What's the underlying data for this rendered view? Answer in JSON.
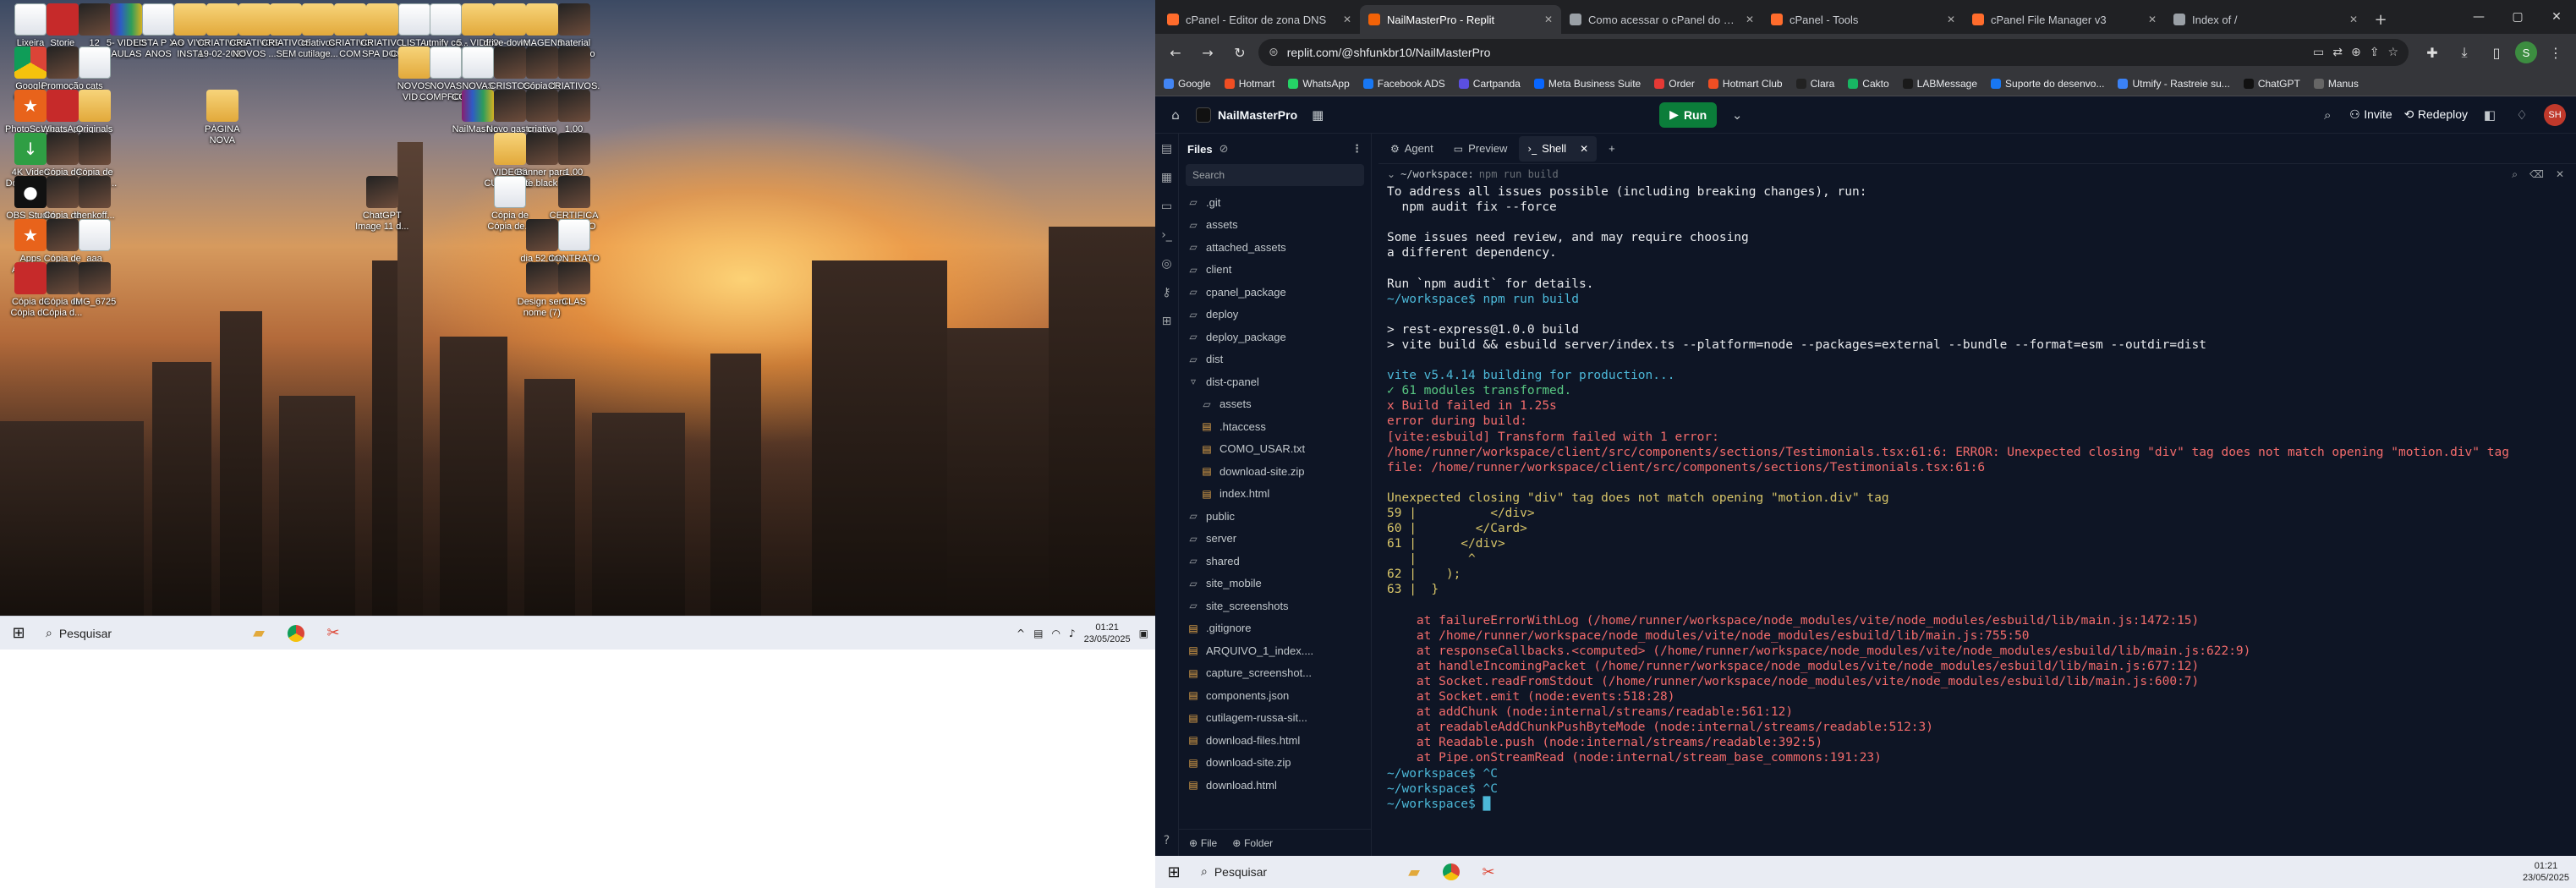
{
  "desktop": {
    "icons": [
      {
        "label": "Lixeira",
        "icon": "recycle-bin-icon",
        "style": "doc",
        "col": 0,
        "row": 0
      },
      {
        "label": "Storie Instagram ...",
        "icon": "phone-image-icon",
        "style": "red",
        "col": 1,
        "row": 0
      },
      {
        "label": "12",
        "icon": "image-icon",
        "style": "img",
        "col": 2,
        "row": 0
      },
      {
        "label": "5- VIDEO AULAS DO...",
        "icon": "winrar-icon",
        "style": "rar",
        "col": 3,
        "row": 0
      },
      {
        "label": "LISTA P X 6 ANOS",
        "icon": "document-icon",
        "style": "doc",
        "col": 4,
        "row": 0
      },
      {
        "label": "AO VIVO INSTA",
        "icon": "folder-icon",
        "style": "folder",
        "col": 5,
        "row": 0
      },
      {
        "label": "CRIATIVOS 19-02-2025",
        "icon": "folder-icon",
        "style": "folder",
        "col": 6,
        "row": 0
      },
      {
        "label": "CRIATIVOS NOVOS ...",
        "icon": "folder-icon",
        "style": "folder",
        "col": 7,
        "row": 0
      },
      {
        "label": "CRIATIVOS SEM LEGE...",
        "icon": "folder-icon",
        "style": "folder",
        "col": 8,
        "row": 0
      },
      {
        "label": "criativos cutilage...",
        "icon": "folder-icon",
        "style": "folder",
        "col": 9,
        "row": 0
      },
      {
        "label": "CRIATIVO COM VALOR",
        "icon": "folder-icon",
        "style": "folder",
        "col": 10,
        "row": 0
      },
      {
        "label": "CRIATIVO SPA DOS PES",
        "icon": "folder-icon",
        "style": "folder",
        "col": 11,
        "row": 0
      },
      {
        "label": "LISTA COMPLE...",
        "icon": "document-icon",
        "style": "doc",
        "col": 12,
        "row": 0
      },
      {
        "label": "utmify cu... DE FEV...",
        "icon": "document-icon",
        "style": "doc",
        "col": 13,
        "row": 0
      },
      {
        "label": "5 - VIDEO AULAS D...",
        "icon": "folder-icon",
        "style": "folder",
        "col": 14,
        "row": 0
      },
      {
        "label": "drive-down...",
        "icon": "folder-icon",
        "style": "folder",
        "col": 15,
        "row": 0
      },
      {
        "label": "IMAGENS CUTILAGEM",
        "icon": "folder-icon",
        "style": "folder",
        "col": 16,
        "row": 0
      },
      {
        "label": "material atualizado",
        "icon": "image-icon",
        "style": "img",
        "col": 17,
        "row": 0
      },
      {
        "label": "Google Chrome",
        "icon": "chrome-icon",
        "style": "chrome",
        "col": 0,
        "row": 1
      },
      {
        "label": "Promoção da semana nai...",
        "icon": "image-icon",
        "style": "img",
        "col": 1,
        "row": 1
      },
      {
        "label": "cats",
        "icon": "document-icon",
        "style": "doc",
        "col": 2,
        "row": 1
      },
      {
        "label": "NOVOS VID...",
        "icon": "folder-icon",
        "style": "folder",
        "col": 12,
        "row": 1
      },
      {
        "label": "NOVAS COMPROS...",
        "icon": "document-icon",
        "style": "doc",
        "col": 13,
        "row": 1
      },
      {
        "label": "NOVAS COMPRAS...",
        "icon": "document-icon",
        "style": "doc",
        "col": 14,
        "row": 1
      },
      {
        "label": "CRISTOS CAPA",
        "icon": "image-icon",
        "style": "img",
        "col": 15,
        "row": 1
      },
      {
        "label": "Cópia de Cópia de...",
        "icon": "image-icon",
        "style": "img",
        "col": 16,
        "row": 1
      },
      {
        "label": "CRIATIVOS...",
        "icon": "image-icon",
        "style": "img",
        "col": 17,
        "row": 1
      },
      {
        "label": "PhotoScape",
        "icon": "photoscape-icon",
        "style": "orange",
        "col": 0,
        "row": 2
      },
      {
        "label": "WhatsApp Image 2025...",
        "icon": "image-icon",
        "style": "red",
        "col": 1,
        "row": 2
      },
      {
        "label": "Originals",
        "icon": "folder-icon",
        "style": "folder",
        "col": 2,
        "row": 2
      },
      {
        "label": "PÁGINA NOVA",
        "icon": "folder-icon",
        "style": "folder",
        "col": 6,
        "row": 2
      },
      {
        "label": "NailMaster...",
        "icon": "winrar-icon",
        "style": "rar",
        "col": 14,
        "row": 2
      },
      {
        "label": "Novo gasto",
        "icon": "image-icon",
        "style": "img",
        "col": 15,
        "row": 2
      },
      {
        "label": "criativo",
        "icon": "image-icon",
        "style": "img",
        "col": 16,
        "row": 2
      },
      {
        "label": "1.00",
        "icon": "image-icon",
        "style": "img",
        "col": 17,
        "row": 2
      },
      {
        "label": "4K Video Downloader",
        "icon": "download-icon",
        "style": "green",
        "col": 0,
        "row": 3
      },
      {
        "label": "Cópia de Cópia de...",
        "icon": "image-icon",
        "style": "img",
        "col": 1,
        "row": 3
      },
      {
        "label": "Cópia de Cópia de...",
        "icon": "image-icon",
        "style": "img",
        "col": 2,
        "row": 3
      },
      {
        "label": "VIDEOS CUTILAGE...",
        "icon": "folder-icon",
        "style": "folder",
        "col": 15,
        "row": 3
      },
      {
        "label": "Banner para site black...",
        "icon": "image-icon",
        "style": "img",
        "col": 16,
        "row": 3
      },
      {
        "label": "1.00",
        "icon": "image-icon",
        "style": "img",
        "col": 17,
        "row": 3
      },
      {
        "label": "OBS Studio",
        "icon": "obs-icon",
        "style": "dark",
        "col": 0,
        "row": 4
      },
      {
        "label": "Cópia de Cópia d...",
        "icon": "image-icon",
        "style": "img",
        "col": 1,
        "row": 4
      },
      {
        "label": "thenkoff...",
        "icon": "image-icon",
        "style": "img",
        "col": 2,
        "row": 4
      },
      {
        "label": "ChatGPT Image 11 d...",
        "icon": "image-icon",
        "style": "img",
        "col": 11,
        "row": 4
      },
      {
        "label": "Cópia de Cópia de...",
        "icon": "document-icon",
        "style": "doc",
        "col": 15,
        "row": 4
      },
      {
        "label": "CERTIFICADO NOVO",
        "icon": "image-icon",
        "style": "img",
        "col": 17,
        "row": 4
      },
      {
        "label": "Apps Animator",
        "icon": "animator-icon",
        "style": "orange",
        "col": 0,
        "row": 5
      },
      {
        "label": "Cópia de Cópia d...",
        "icon": "image-icon",
        "style": "img",
        "col": 1,
        "row": 5
      },
      {
        "label": "aaa",
        "icon": "document-icon",
        "style": "doc",
        "col": 2,
        "row": 5
      },
      {
        "label": "dia 52.doc",
        "icon": "image-icon",
        "style": "img",
        "col": 16,
        "row": 5
      },
      {
        "label": "CONTRATO",
        "icon": "document-icon",
        "style": "doc",
        "col": 17,
        "row": 5
      },
      {
        "label": "Cópia de Cópia d...",
        "icon": "image-icon",
        "style": "red",
        "col": 0,
        "row": 6
      },
      {
        "label": "Cópia de Cópia d...",
        "icon": "image-icon",
        "style": "img",
        "col": 1,
        "row": 6
      },
      {
        "label": "IMG_6725",
        "icon": "image-icon",
        "style": "img",
        "col": 2,
        "row": 6
      },
      {
        "label": "Design sem nome (7)",
        "icon": "image-icon",
        "style": "img",
        "col": 16,
        "row": 6
      },
      {
        "label": "CLAS",
        "icon": "image-icon",
        "style": "img",
        "col": 17,
        "row": 6
      }
    ]
  },
  "taskbar_left": {
    "search_placeholder": "Pesquisar",
    "time": "01:21",
    "date": "23/05/2025"
  },
  "taskbar_right": {
    "search_placeholder": "Pesquisar",
    "time": "01:21",
    "date": "23/05/2025"
  },
  "browser": {
    "tabs": [
      {
        "title": "cPanel - Editor de zona DNS",
        "favicon_color": "#ff6c2c",
        "active": false
      },
      {
        "title": "NailMasterPro - Replit",
        "favicon_color": "#f26207",
        "active": true
      },
      {
        "title": "Como acessar o cPanel do site",
        "favicon_color": "#9aa0a6",
        "active": false
      },
      {
        "title": "cPanel - Tools",
        "favicon_color": "#ff6c2c",
        "active": false
      },
      {
        "title": "cPanel File Manager v3",
        "favicon_color": "#ff6c2c",
        "active": false
      },
      {
        "title": "Index of /",
        "favicon_color": "#9aa0a6",
        "active": false
      }
    ],
    "url": "replit.com/@shfunkbr10/NailMasterPro",
    "profile_initial": "S",
    "bookmarks": [
      {
        "label": "Google",
        "color": "#4285f4"
      },
      {
        "label": "Hotmart",
        "color": "#f04e23"
      },
      {
        "label": "WhatsApp",
        "color": "#25d366"
      },
      {
        "label": "Facebook ADS",
        "color": "#1877f2"
      },
      {
        "label": "Cartpanda",
        "color": "#5b4fe0"
      },
      {
        "label": "Meta Business Suite",
        "color": "#0866ff"
      },
      {
        "label": "Order",
        "color": "#e53935"
      },
      {
        "label": "Hotmart Club",
        "color": "#f04e23"
      },
      {
        "label": "Clara",
        "color": "#222222"
      },
      {
        "label": "Cakto",
        "color": "#18b663"
      },
      {
        "label": "LABMessage",
        "color": "#1a1a1a"
      },
      {
        "label": "Suporte do desenvo...",
        "color": "#1877f2"
      },
      {
        "label": "Utmify - Rastreie su...",
        "color": "#3b82f6"
      },
      {
        "label": "ChatGPT",
        "color": "#111111"
      },
      {
        "label": "Manus",
        "color": "#666666"
      }
    ]
  },
  "replit": {
    "project_name": "NailMasterPro",
    "run_label": "Run",
    "invite_label": "Invite",
    "redeploy_label": "Redeploy",
    "user_initials": "SH",
    "files": {
      "title": "Files",
      "search_placeholder": "Search",
      "new_file": "File",
      "new_folder": "Folder",
      "tree": [
        {
          "name": ".git",
          "type": "folder",
          "depth": 0
        },
        {
          "name": "assets",
          "type": "folder",
          "depth": 0
        },
        {
          "name": "attached_assets",
          "type": "folder",
          "depth": 0
        },
        {
          "name": "client",
          "type": "folder",
          "depth": 0
        },
        {
          "name": "cpanel_package",
          "type": "folder",
          "depth": 0
        },
        {
          "name": "deploy",
          "type": "folder",
          "depth": 0
        },
        {
          "name": "deploy_package",
          "type": "folder",
          "depth": 0
        },
        {
          "name": "dist",
          "type": "folder",
          "depth": 0
        },
        {
          "name": "dist-cpanel",
          "type": "folder-open",
          "depth": 0
        },
        {
          "name": "assets",
          "type": "folder",
          "depth": 1
        },
        {
          "name": ".htaccess",
          "type": "file",
          "depth": 1
        },
        {
          "name": "COMO_USAR.txt",
          "type": "file",
          "depth": 1
        },
        {
          "name": "download-site.zip",
          "type": "file",
          "depth": 1
        },
        {
          "name": "index.html",
          "type": "file",
          "depth": 1
        },
        {
          "name": "public",
          "type": "folder",
          "depth": 0
        },
        {
          "name": "server",
          "type": "folder",
          "depth": 0
        },
        {
          "name": "shared",
          "type": "folder",
          "depth": 0
        },
        {
          "name": "site_mobile",
          "type": "folder",
          "depth": 0
        },
        {
          "name": "site_screenshots",
          "type": "folder",
          "depth": 0
        },
        {
          "name": ".gitignore",
          "type": "file",
          "depth": 0
        },
        {
          "name": "ARQUIVO_1_index....",
          "type": "file",
          "depth": 0
        },
        {
          "name": "capture_screenshot...",
          "type": "file",
          "depth": 0
        },
        {
          "name": "components.json",
          "type": "file",
          "depth": 0
        },
        {
          "name": "cutilagem-russa-sit...",
          "type": "file",
          "depth": 0
        },
        {
          "name": "download-files.html",
          "type": "file",
          "depth": 0
        },
        {
          "name": "download-site.zip",
          "type": "file",
          "depth": 0
        },
        {
          "name": "download.html",
          "type": "file",
          "depth": 0
        }
      ]
    },
    "editor_tabs": [
      {
        "label": "Agent",
        "icon": "agent-icon",
        "glyph": "⚙",
        "active": false,
        "closable": false
      },
      {
        "label": "Preview",
        "icon": "preview-icon",
        "glyph": "▭",
        "active": false,
        "closable": false
      },
      {
        "label": "Shell",
        "icon": "shell-icon",
        "glyph": "›_",
        "active": true,
        "closable": true
      },
      {
        "label": "+",
        "icon": "plus-icon",
        "glyph": "",
        "active": false,
        "closable": false
      }
    ],
    "shell": {
      "header_path": "~/workspace:",
      "header_cmd": "npm run build",
      "lines": [
        {
          "text": "To address all issues possible (including breaking changes), run:",
          "color": "def"
        },
        {
          "text": "  npm audit fix --force",
          "color": "def"
        },
        {
          "text": "",
          "color": "def"
        },
        {
          "text": "Some issues need review, and may require choosing",
          "color": "def"
        },
        {
          "text": "a different dependency.",
          "color": "def"
        },
        {
          "text": "",
          "color": "def"
        },
        {
          "text": "Run `npm audit` for details.",
          "color": "def"
        },
        {
          "text": "~/workspace$ npm run build",
          "color": "cmd"
        },
        {
          "text": "",
          "color": "def"
        },
        {
          "text": "> rest-express@1.0.0 build",
          "color": "def"
        },
        {
          "text": "> vite build && esbuild server/index.ts --platform=node --packages=external --bundle --format=esm --outdir=dist",
          "color": "def"
        },
        {
          "text": "",
          "color": "def"
        },
        {
          "text": "vite v5.4.14 building for production...",
          "color": "cyan"
        },
        {
          "text": "✓ 61 modules transformed.",
          "color": "green"
        },
        {
          "text": "x Build failed in 1.25s",
          "color": "red"
        },
        {
          "text": "error during build:",
          "color": "red"
        },
        {
          "text": "[vite:esbuild] Transform failed with 1 error:",
          "color": "red"
        },
        {
          "text": "/home/runner/workspace/client/src/components/sections/Testimonials.tsx:61:6: ERROR: Unexpected closing \"div\" tag does not match opening \"motion.div\" tag",
          "color": "red"
        },
        {
          "text": "file: /home/runner/workspace/client/src/components/sections/Testimonials.tsx:61:6",
          "color": "red"
        },
        {
          "text": "",
          "color": "def"
        },
        {
          "text": "Unexpected closing \"div\" tag does not match opening \"motion.div\" tag",
          "color": "yellow"
        },
        {
          "text": "59 |          </div>",
          "color": "yellow"
        },
        {
          "text": "60 |        </Card>",
          "color": "yellow"
        },
        {
          "text": "61 |      </div>",
          "color": "yellow"
        },
        {
          "text": "   |       ^",
          "color": "yellow"
        },
        {
          "text": "62 |    );",
          "color": "yellow"
        },
        {
          "text": "63 |  }",
          "color": "yellow"
        },
        {
          "text": "",
          "color": "def"
        },
        {
          "text": "    at failureErrorWithLog (/home/runner/workspace/node_modules/vite/node_modules/esbuild/lib/main.js:1472:15)",
          "color": "red"
        },
        {
          "text": "    at /home/runner/workspace/node_modules/vite/node_modules/esbuild/lib/main.js:755:50",
          "color": "red"
        },
        {
          "text": "    at responseCallbacks.<computed> (/home/runner/workspace/node_modules/vite/node_modules/esbuild/lib/main.js:622:9)",
          "color": "red"
        },
        {
          "text": "    at handleIncomingPacket (/home/runner/workspace/node_modules/vite/node_modules/esbuild/lib/main.js:677:12)",
          "color": "red"
        },
        {
          "text": "    at Socket.readFromStdout (/home/runner/workspace/node_modules/vite/node_modules/esbuild/lib/main.js:600:7)",
          "color": "red"
        },
        {
          "text": "    at Socket.emit (node:events:518:28)",
          "color": "red"
        },
        {
          "text": "    at addChunk (node:internal/streams/readable:561:12)",
          "color": "red"
        },
        {
          "text": "    at readableAddChunkPushByteMode (node:internal/streams/readable:512:3)",
          "color": "red"
        },
        {
          "text": "    at Readable.push (node:internal/streams/readable:392:5)",
          "color": "red"
        },
        {
          "text": "    at Pipe.onStreamRead (node:internal/stream_base_commons:191:23)",
          "color": "red"
        },
        {
          "text": "~/workspace$ ^C",
          "color": "cmd"
        },
        {
          "text": "~/workspace$ ^C",
          "color": "cmd"
        },
        {
          "text": "~/workspace$ █",
          "color": "cmd"
        }
      ]
    }
  }
}
